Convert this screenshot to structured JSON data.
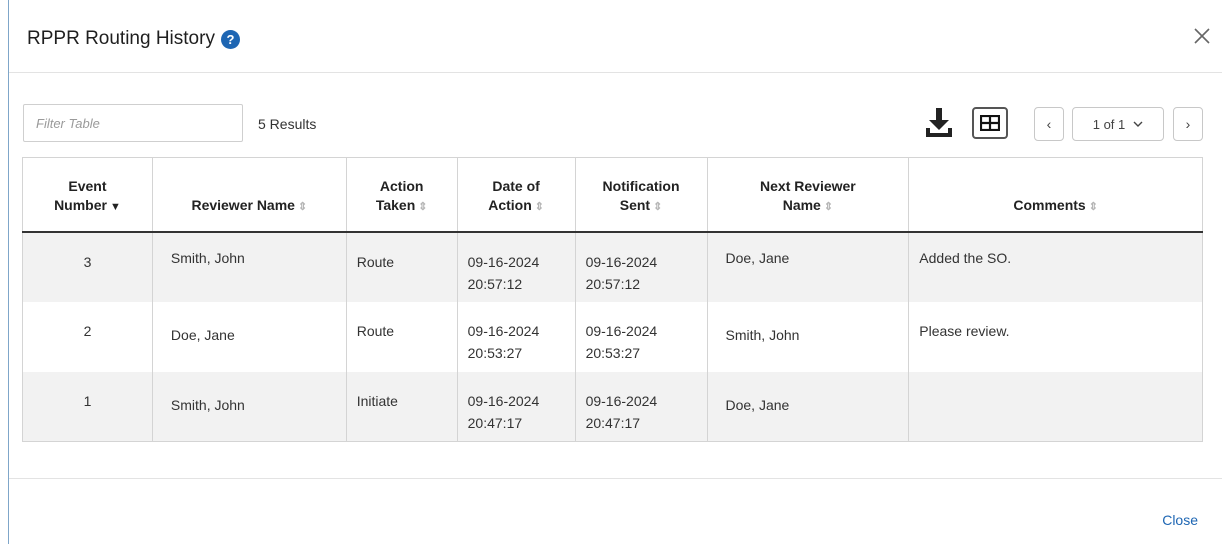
{
  "modal": {
    "title": "RPPR Routing History",
    "help_icon": "question-circle-icon",
    "close_icon": "close-x-icon",
    "footer_close_label": "Close"
  },
  "toolbar": {
    "filter_placeholder": "Filter Table",
    "filter_value": "",
    "results_text": "5 Results",
    "download_icon": "download-icon",
    "columns_icon": "table-grid-icon",
    "prev_label": "‹",
    "next_label": "›",
    "page_label": "1 of 1"
  },
  "table": {
    "headers": {
      "event": [
        "Event",
        "Number"
      ],
      "reviewer": "Reviewer Name",
      "action": [
        "Action",
        "Taken"
      ],
      "date": [
        "Date of",
        "Action"
      ],
      "notification": [
        "Notification",
        "Sent"
      ],
      "next_reviewer": [
        "Next Reviewer",
        "Name"
      ],
      "comments": "Comments"
    },
    "rows": [
      {
        "event": "3",
        "reviewer": "Smith, John",
        "action": "Route",
        "date": [
          "09-16-2024",
          "20:57:12"
        ],
        "notification": [
          "09-16-2024",
          "20:57:12"
        ],
        "next_reviewer": "Doe, Jane",
        "comments": "Added the SO."
      },
      {
        "event": "2",
        "reviewer": "Doe, Jane",
        "action": "Route",
        "date": [
          "09-16-2024",
          "20:53:27"
        ],
        "notification": [
          "09-16-2024",
          "20:53:27"
        ],
        "next_reviewer": "Smith, John",
        "comments": "Please review."
      },
      {
        "event": "1",
        "reviewer": "Smith, John",
        "action": "Initiate",
        "date": [
          "09-16-2024",
          "20:47:17"
        ],
        "notification": [
          "09-16-2024",
          "20:47:17"
        ],
        "next_reviewer": "Doe, Jane",
        "comments": ""
      }
    ]
  },
  "colors": {
    "accent": "#1e66b3",
    "row_stripe": "#f2f2f2",
    "border": "#d4d4d4"
  }
}
